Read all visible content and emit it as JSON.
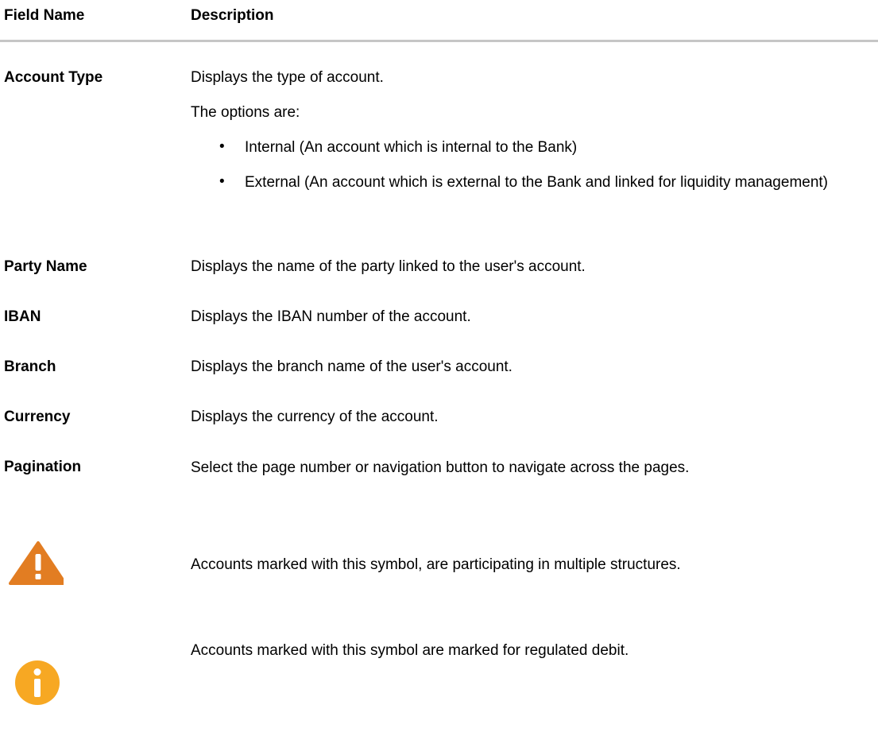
{
  "header": {
    "field_name": "Field Name",
    "description": "Description"
  },
  "rows": {
    "account_type": {
      "field": "Account Type",
      "description": "Displays the type of account.",
      "options_title": "The options are:",
      "options": [
        "Internal (An account which is internal to the Bank)",
        "External (An account which is external to the Bank and linked for liquidity management)"
      ]
    },
    "party_name": {
      "field": "Party Name",
      "description": "Displays the name of the party linked to the user's account."
    },
    "iban": {
      "field": "IBAN",
      "description": "Displays the IBAN number of the account."
    },
    "branch": {
      "field": "Branch",
      "description": "Displays the branch name of the user's account."
    },
    "currency": {
      "field": "Currency",
      "description": "Displays the currency of the account."
    },
    "pagination": {
      "field": "Pagination",
      "description": "Select the page number or navigation button to navigate across the pages."
    },
    "warning_symbol": {
      "icon": "warning-triangle-icon",
      "description": "Accounts marked with this symbol, are participating in multiple structures."
    },
    "info_symbol": {
      "icon": "info-circle-icon",
      "description": "Accounts marked with this symbol are marked for regulated debit."
    }
  },
  "colors": {
    "header_rule": "#c6c6c6",
    "warning_icon": "#e27d22",
    "info_icon": "#f7a823"
  }
}
